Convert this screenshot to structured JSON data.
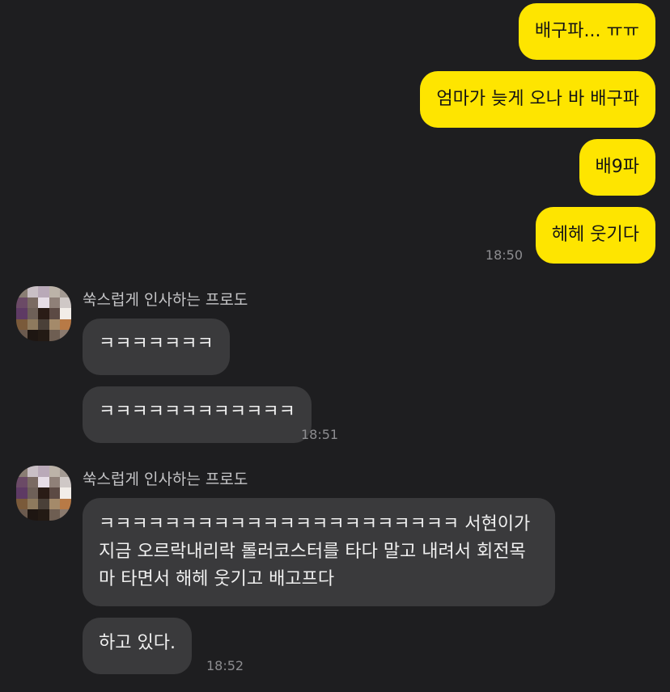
{
  "chat": {
    "sent": [
      {
        "text": "배구파... ㅠㅠ"
      },
      {
        "text": "엄마가 늦게 오나 바 배구파"
      },
      {
        "text": "배9파"
      },
      {
        "text": "헤헤 웃기다"
      }
    ],
    "sent_time": "18:50",
    "groups": [
      {
        "sender": "쑥스럽게 인사하는 프로도",
        "messages": [
          "ㅋㅋㅋㅋㅋㅋㅋ",
          "ㅋㅋㅋㅋㅋㅋㅋㅋㅋㅋㅋㅋ"
        ],
        "time": "18:51"
      },
      {
        "sender": "쑥스럽게 인사하는 프로도",
        "messages": [
          "ㅋㅋㅋㅋㅋㅋㅋㅋㅋㅋㅋㅋㅋㅋㅋㅋㅋㅋㅋㅋㅋㅋ 서현이가 지금 오르락내리락 롤러코스터를 타다 말고 내려서 회전목마 타면서 해헤 웃기고 배고프다",
          "하고 있다."
        ],
        "time": "18:52"
      }
    ]
  },
  "colors": {
    "background": "#1e1e20",
    "sent_bubble": "#fee500",
    "received_bubble": "#3a3a3c"
  },
  "icons": {
    "avatar": "pixelated-profile-avatar"
  }
}
